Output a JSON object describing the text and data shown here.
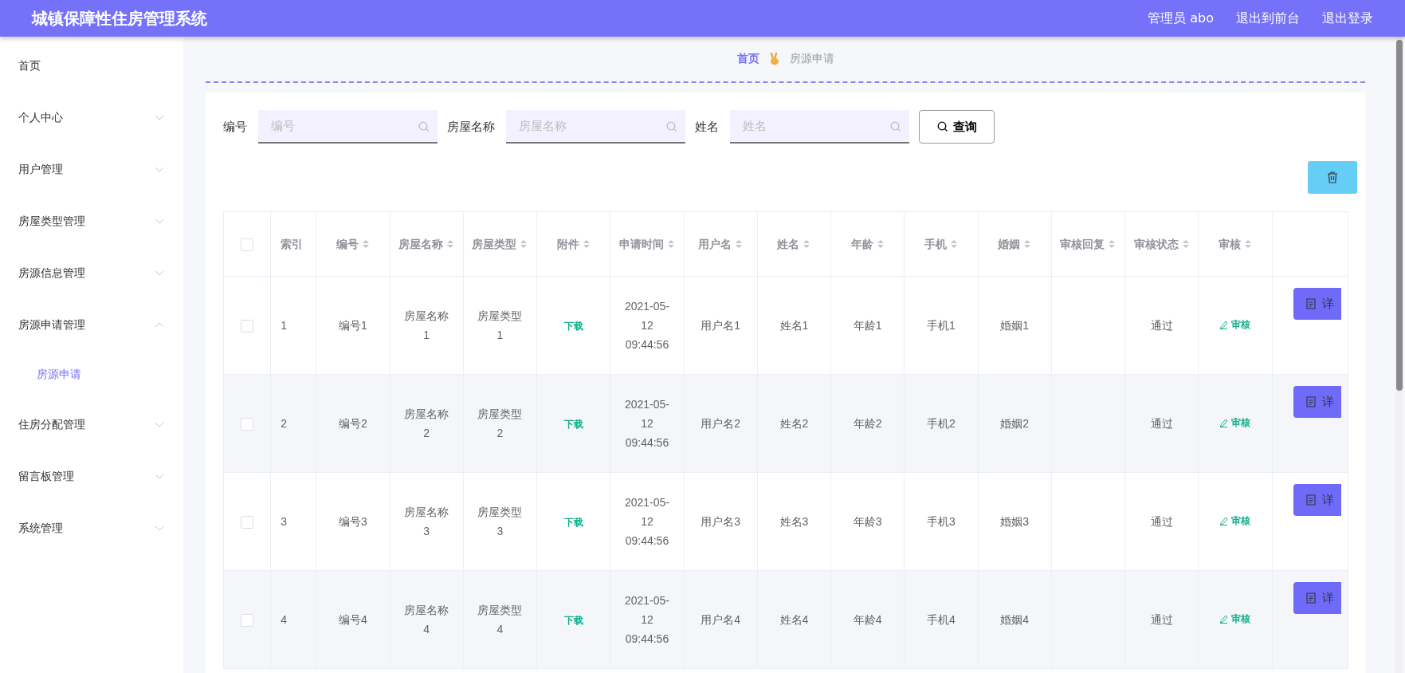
{
  "header": {
    "title": "城镇保障性住房管理系统",
    "user": "管理员 abo",
    "links": [
      "退出到前台",
      "退出登录"
    ]
  },
  "sidebar": {
    "items": [
      {
        "label": "首页",
        "kind": "link"
      },
      {
        "label": "个人中心",
        "kind": "menu",
        "expanded": false
      },
      {
        "label": "用户管理",
        "kind": "menu",
        "expanded": false
      },
      {
        "label": "房屋类型管理",
        "kind": "menu",
        "expanded": false
      },
      {
        "label": "房源信息管理",
        "kind": "menu",
        "expanded": false
      },
      {
        "label": "房源申请管理",
        "kind": "menu",
        "expanded": true,
        "children": [
          {
            "label": "房源申请",
            "selected": true
          }
        ]
      },
      {
        "label": "住房分配管理",
        "kind": "menu",
        "expanded": false
      },
      {
        "label": "留言板管理",
        "kind": "menu",
        "expanded": false
      },
      {
        "label": "系统管理",
        "kind": "menu",
        "expanded": false
      }
    ]
  },
  "breadcrumb": [
    "首页",
    "房源申请"
  ],
  "search": {
    "fields": [
      {
        "label": "编号",
        "placeholder": "编号"
      },
      {
        "label": "房屋名称",
        "placeholder": "房屋名称"
      },
      {
        "label": "姓名",
        "placeholder": "姓名"
      }
    ],
    "button": "查询"
  },
  "table": {
    "all_checked": false,
    "columns": [
      {
        "label": "索引",
        "sortable": false
      },
      {
        "label": "编号",
        "sortable": true
      },
      {
        "label": "房屋名称",
        "sortable": true
      },
      {
        "label": "房屋类型",
        "sortable": true
      },
      {
        "label": "附件",
        "sortable": true
      },
      {
        "label": "申请时间",
        "sortable": true
      },
      {
        "label": "用户名",
        "sortable": true
      },
      {
        "label": "姓名",
        "sortable": true
      },
      {
        "label": "年龄",
        "sortable": true
      },
      {
        "label": "手机",
        "sortable": true
      },
      {
        "label": "婚姻",
        "sortable": true
      },
      {
        "label": "审核回复",
        "sortable": true
      },
      {
        "label": "审核状态",
        "sortable": true
      },
      {
        "label": "审核",
        "sortable": true
      }
    ],
    "rows": [
      {
        "checked": false,
        "cells": [
          "1",
          "编号1",
          "房屋名称1",
          "房屋类型1",
          "下载",
          "2021-05-12 09:44:56",
          "用户名1",
          "姓名1",
          "年龄1",
          "手机1",
          "婚姻1",
          "",
          "通过",
          "审核"
        ],
        "button": "详"
      },
      {
        "checked": false,
        "cells": [
          "2",
          "编号2",
          "房屋名称2",
          "房屋类型2",
          "下载",
          "2021-05-12 09:44:56",
          "用户名2",
          "姓名2",
          "年龄2",
          "手机2",
          "婚姻2",
          "",
          "通过",
          "审核"
        ],
        "button": "详"
      },
      {
        "checked": false,
        "cells": [
          "3",
          "编号3",
          "房屋名称3",
          "房屋类型3",
          "下载",
          "2021-05-12 09:44:56",
          "用户名3",
          "姓名3",
          "年龄3",
          "手机3",
          "婚姻3",
          "",
          "通过",
          "审核"
        ],
        "button": "详"
      },
      {
        "checked": false,
        "cells": [
          "4",
          "编号4",
          "房屋名称4",
          "房屋类型4",
          "下载",
          "2021-05-12 09:44:56",
          "用户名4",
          "姓名4",
          "年龄4",
          "手机4",
          "婚姻4",
          "",
          "通过",
          "审核"
        ],
        "button": "详"
      }
    ]
  }
}
